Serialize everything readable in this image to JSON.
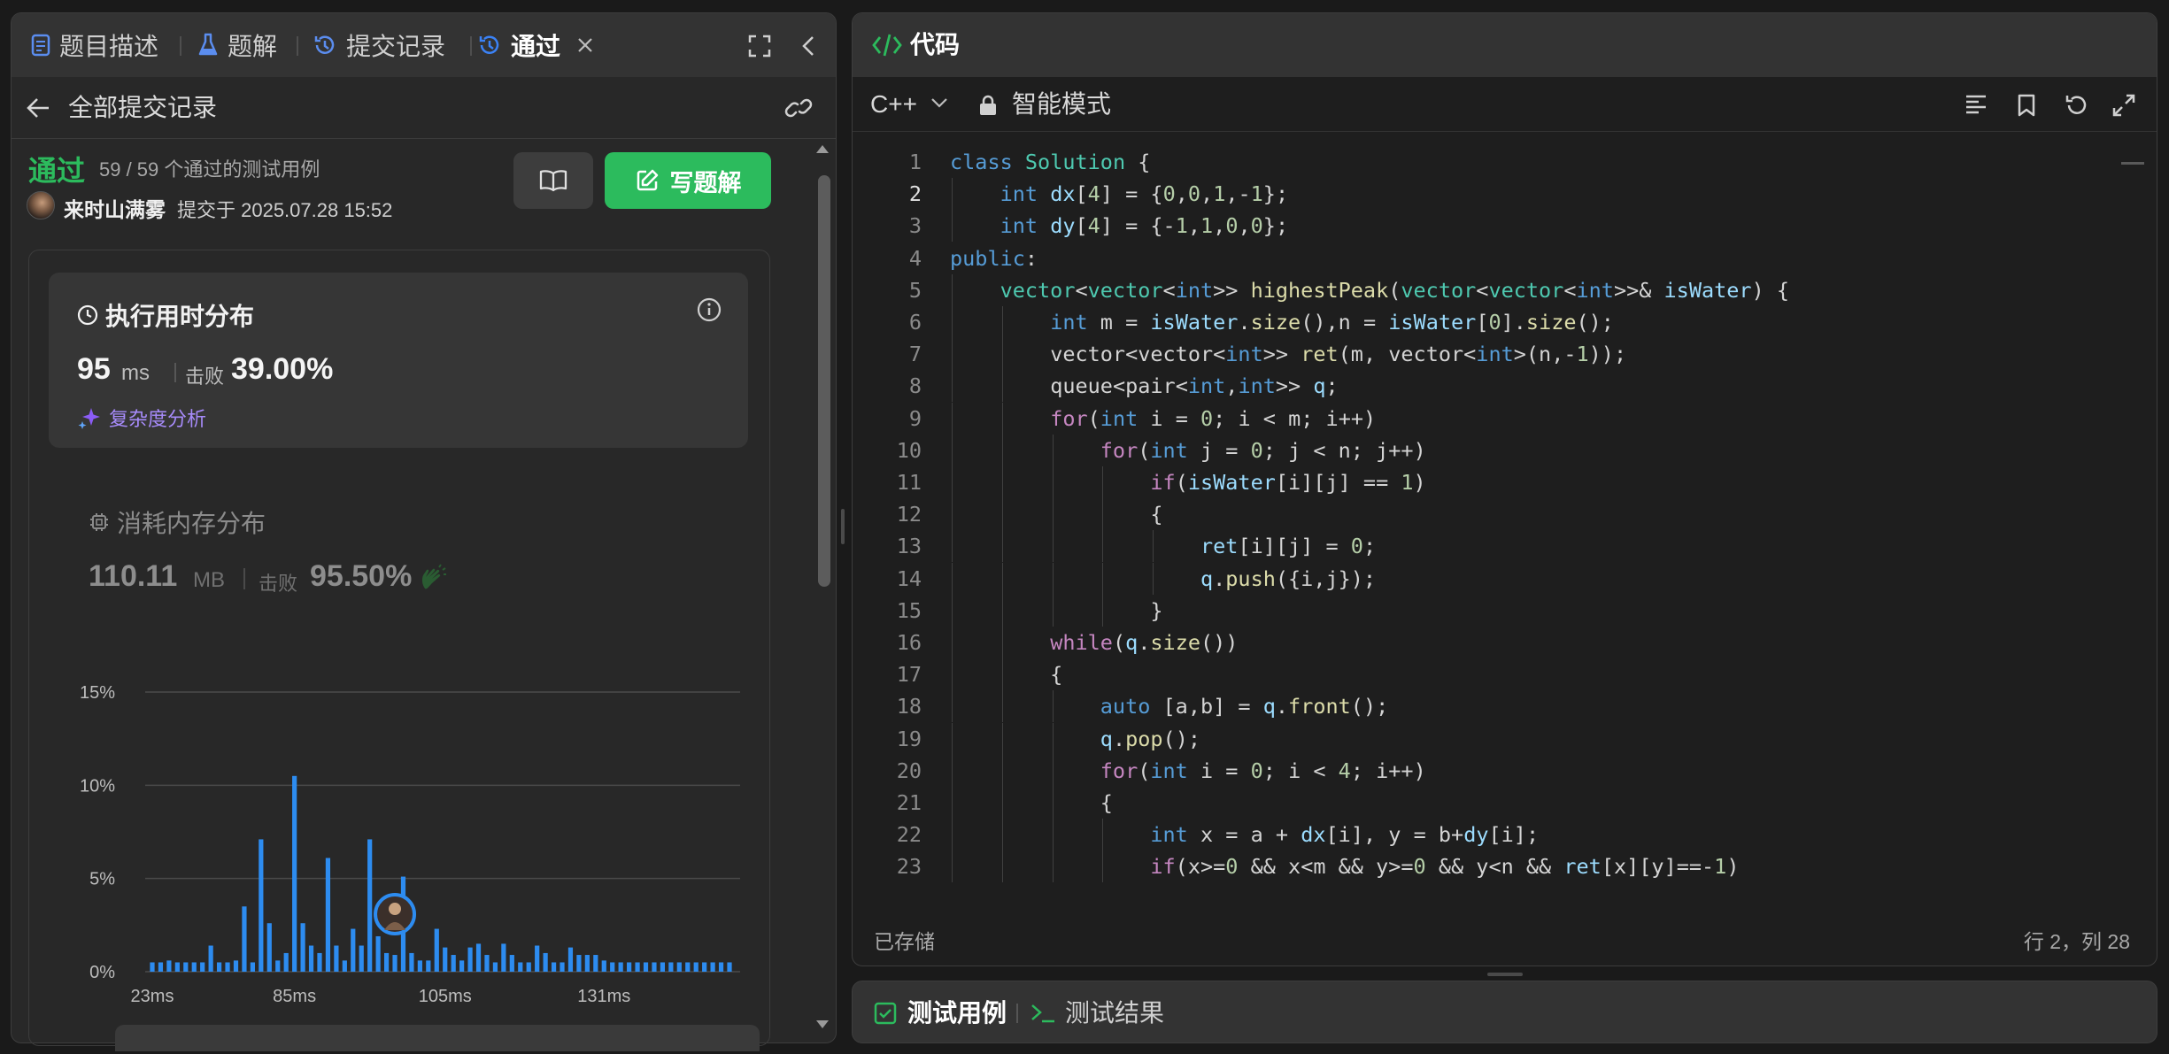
{
  "left_tabs": [
    {
      "label": "题目描述",
      "icon": "doc-icon"
    },
    {
      "label": "题解",
      "icon": "flask-icon"
    },
    {
      "label": "提交记录",
      "icon": "history-icon"
    },
    {
      "label": "通过",
      "icon": "history-icon"
    }
  ],
  "left_header": {
    "back_label": "全部提交记录"
  },
  "submission": {
    "status": "通过",
    "cases": "59 / 59 个通过的测试用例",
    "user": "来时山满雾",
    "submitted": "提交于 2025.07.28 15:52",
    "write_solution": "写题解"
  },
  "runtime": {
    "title": "执行用时分布",
    "value": "95",
    "unit": "ms",
    "beats_label": "击败",
    "beats_pct": "39.00%",
    "complexity_link": "复杂度分析"
  },
  "memory": {
    "title": "消耗内存分布",
    "value": "110.11",
    "unit": "MB",
    "beats_label": "击败",
    "beats_pct": "95.50%"
  },
  "chart_data": {
    "type": "bar",
    "ylabel": "",
    "xlabel": "",
    "y_ticks": [
      "15%",
      "10%",
      "5%",
      "0%"
    ],
    "ylim": [
      0,
      15
    ],
    "x_tick_labels": [
      "23ms",
      "85ms",
      "105ms",
      "131ms"
    ],
    "values": [
      0.5,
      0.5,
      0.6,
      0.5,
      0.5,
      0.5,
      0.5,
      1.4,
      0.5,
      0.5,
      0.6,
      3.5,
      0.5,
      7.1,
      2.6,
      0.6,
      1.0,
      10.5,
      2.6,
      1.4,
      1.0,
      6.1,
      1.4,
      0.6,
      2.3,
      1.4,
      7.1,
      1.9,
      1.0,
      0.9,
      5.1,
      1.0,
      0.6,
      0.6,
      2.3,
      1.3,
      0.9,
      0.6,
      1.3,
      1.5,
      0.9,
      0.5,
      1.5,
      0.9,
      0.5,
      0.5,
      1.4,
      1.0,
      0.5,
      0.5,
      1.3,
      0.9,
      0.9,
      0.9,
      0.6,
      0.5,
      0.5,
      0.5,
      0.5,
      0.5,
      0.5,
      0.5,
      0.5,
      0.5,
      0.5,
      0.5,
      0.5,
      0.5,
      0.5,
      0.5
    ],
    "highlight_index": 29,
    "bar_color": "#2d8cf0"
  },
  "editor": {
    "title": "代码",
    "language": "C++",
    "mode": "智能模式",
    "saved": "已存储",
    "cursor": "行 2，列 28",
    "lines": [
      "class Solution {",
      "    int dx[4] = {0,0,1,-1};",
      "    int dy[4] = {-1,1,0,0};",
      "public:",
      "    vector<vector<int>> highestPeak(vector<vector<int>>& isWater) {",
      "        int m = isWater.size(),n = isWater[0].size();",
      "        vector<vector<int>> ret(m, vector<int>(n,-1));",
      "        queue<pair<int,int>> q;",
      "        for(int i = 0; i < m; i++)",
      "            for(int j = 0; j < n; j++)",
      "                if(isWater[i][j] == 1)",
      "                {",
      "                    ret[i][j] = 0;",
      "                    q.push({i,j});",
      "                }",
      "        while(q.size())",
      "        {",
      "            auto [a,b] = q.front();",
      "            q.pop();",
      "            for(int i = 0; i < 4; i++)",
      "            {",
      "                int x = a + dx[i], y = b+dy[i];",
      "                if(x>=0 && x<m && y>=0 && y<n && ret[x][y]==-1)"
    ]
  },
  "test_panel": {
    "tab1": "测试用例",
    "tab2": "测试结果"
  },
  "colors": {
    "accent_green": "#2cbb5d",
    "bar_blue": "#2d8cf0",
    "purple": "#a78bfa"
  }
}
